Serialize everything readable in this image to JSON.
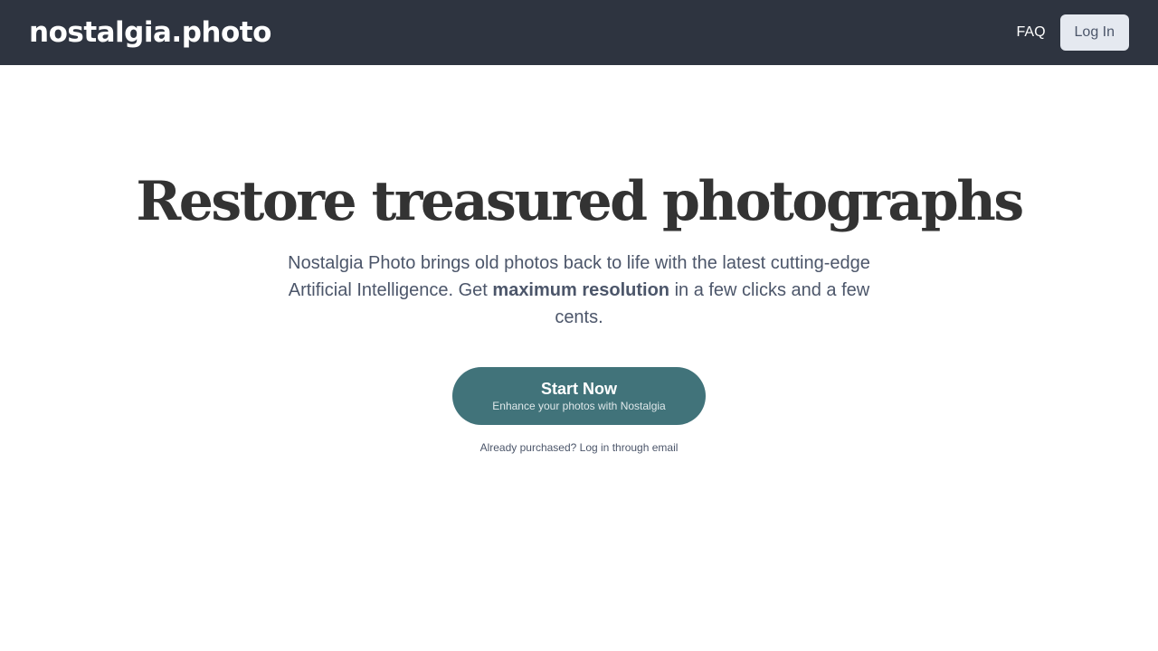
{
  "header": {
    "logo_text": "nostalgia.photo",
    "faq_label": "FAQ",
    "login_label": "Log In"
  },
  "hero": {
    "title": "Restore treasured photographs",
    "subtitle_before": "Nostalgia Photo brings old photos back to life with the latest cutting-edge Artificial Intelligence. Get ",
    "subtitle_bold": "maximum resolution",
    "subtitle_after": " in a few clicks and a few cents.",
    "cta_label": "Start Now",
    "cta_sublabel": "Enhance your photos with Nostalgia",
    "email_login_text": "Already purchased? Log in through email"
  },
  "colors": {
    "header_bg": "#2e3440",
    "login_bg": "#e5e9f0",
    "login_text": "#4c566a",
    "title_text": "#333333",
    "body_text": "#4c566a",
    "cta_bg": "#41737a"
  }
}
